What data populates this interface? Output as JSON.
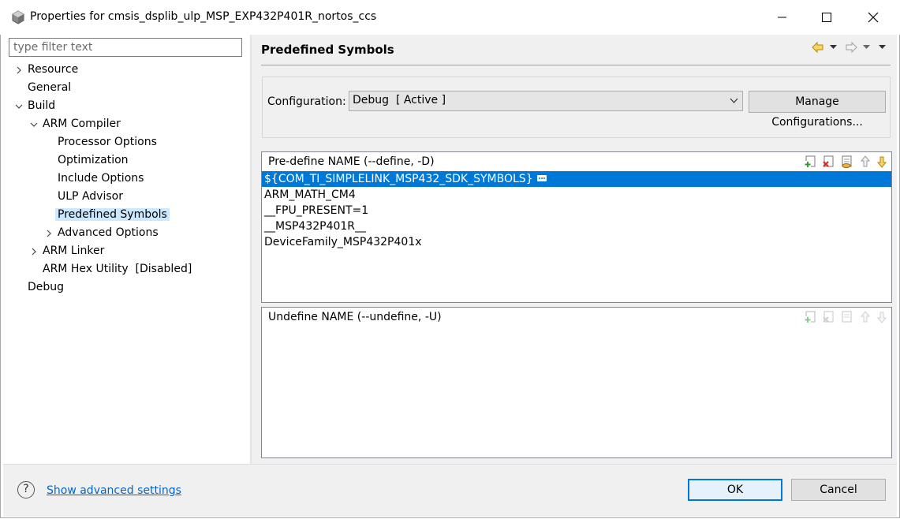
{
  "window": {
    "title": "Properties for cmsis_dsplib_ulp_MSP_EXP432P401R_nortos_ccs",
    "controls": [
      "minimize",
      "maximize",
      "close"
    ]
  },
  "filter": {
    "placeholder": "type filter text",
    "value": ""
  },
  "tree": [
    {
      "label": "Resource",
      "expander": "collapsed"
    },
    {
      "label": "General",
      "expander": "none"
    },
    {
      "label": "Build",
      "expander": "expanded"
    },
    {
      "label": "ARM Compiler",
      "expander": "expanded"
    },
    {
      "label": "Processor Options",
      "expander": "none"
    },
    {
      "label": "Optimization",
      "expander": "none"
    },
    {
      "label": "Include Options",
      "expander": "none"
    },
    {
      "label": "ULP Advisor",
      "expander": "none"
    },
    {
      "label": "Predefined Symbols",
      "expander": "none",
      "selected": true
    },
    {
      "label": "Advanced Options",
      "expander": "collapsed"
    },
    {
      "label": "ARM Linker",
      "expander": "collapsed"
    },
    {
      "label": "ARM Hex Utility  [Disabled]",
      "expander": "none"
    },
    {
      "label": "Debug",
      "expander": "none"
    }
  ],
  "page": {
    "title": "Predefined Symbols",
    "nav_icons": [
      "back-arrow-icon",
      "dropdown-icon",
      "forward-arrow-icon",
      "dropdown-icon",
      "menu-icon"
    ]
  },
  "config": {
    "label": "Configuration:",
    "selected": "Debug  [ Active ]",
    "manage_label": "Manage Configurations..."
  },
  "predefine": {
    "header": "Pre-define NAME (--define, -D)",
    "items": [
      "${COM_TI_SIMPLELINK_MSP432_SDK_SYMBOLS}",
      "ARM_MATH_CM4",
      "__FPU_PRESENT=1",
      "__MSP432P401R__",
      "DeviceFamily_MSP432P401x"
    ],
    "selected_index": 0,
    "toolbar": [
      "add-icon",
      "delete-icon",
      "edit-icon",
      "move-up-icon",
      "move-down-icon"
    ]
  },
  "undefine": {
    "header": "Undefine NAME (--undefine, -U)",
    "items": [],
    "toolbar": [
      "add-icon",
      "delete-icon",
      "edit-icon",
      "move-up-icon",
      "move-down-icon"
    ]
  },
  "footer": {
    "help_glyph": "?",
    "advanced_link": "Show advanced settings",
    "ok_label": "OK",
    "cancel_label": "Cancel"
  },
  "colors": {
    "selection": "#0078d7",
    "tree_selection": "#cce8ff",
    "link": "#0066cc",
    "panel_bg": "#f0f0f0"
  }
}
